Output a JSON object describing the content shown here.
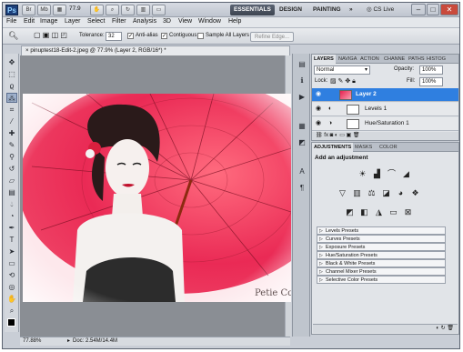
{
  "titlebar": {
    "app_logo": "Ps",
    "zoom": "77.9",
    "workspaces": [
      "ESSENTIALS",
      "DESIGN",
      "PAINTING",
      "»"
    ],
    "cs_live": "CS Live",
    "window_controls": [
      "–",
      "□",
      "✕"
    ]
  },
  "menu": [
    "File",
    "Edit",
    "Image",
    "Layer",
    "Select",
    "Filter",
    "Analysis",
    "3D",
    "View",
    "Window",
    "Help"
  ],
  "options": {
    "tolerance_label": "Tolerance:",
    "tolerance_value": "32",
    "anti_alias_label": "Anti-alias",
    "contiguous_label": "Contiguous",
    "sample_all_label": "Sample All Layers",
    "refine_edge_label": "Refine Edge..."
  },
  "document": {
    "tab_title": "pinuptest18-Edit-2.jpeg @ 77.9% (Layer 2, RGB/16*) *",
    "zoom_status": "77.88%",
    "doc_info": "Doc: 2.54M/14.4M",
    "signature": "Petie Co"
  },
  "layers_panel": {
    "tabs": [
      "LAYERS",
      "NAVIGA",
      "ACTION",
      "CHANNE",
      "PATHS",
      "HISTOG"
    ],
    "blend_mode": "Normal",
    "opacity_label": "Opacity:",
    "opacity_value": "100%",
    "lock_label": "Lock:",
    "fill_label": "Fill:",
    "fill_value": "100%",
    "layers": [
      {
        "name": "Layer 2",
        "selected": true
      },
      {
        "name": "Levels 1",
        "selected": false
      },
      {
        "name": "Hue/Saturation 1",
        "selected": false
      }
    ]
  },
  "adjustments_panel": {
    "tabs": [
      "ADJUSTMENTS",
      "MASKS",
      "COLOR"
    ],
    "heading": "Add an adjustment",
    "presets": [
      "Levels Presets",
      "Curves Presets",
      "Exposure Presets",
      "Hue/Saturation Presets",
      "Black & White Presets",
      "Channel Mixer Presets",
      "Selective Color Presets"
    ]
  },
  "colors": {
    "accent_selected": "#2f7fe0",
    "art_red": "#e8204f"
  }
}
